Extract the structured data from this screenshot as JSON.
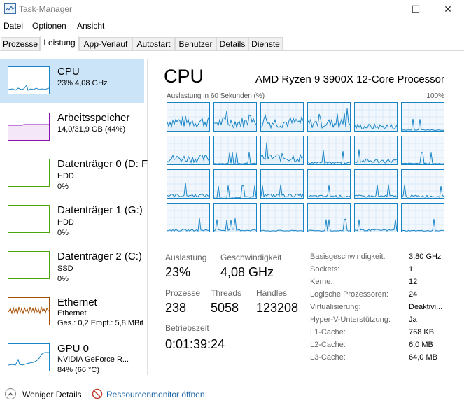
{
  "window": {
    "title": "Task-Manager",
    "minimize": "—",
    "maximize": "☐",
    "close": "✕"
  },
  "menu": [
    "Datei",
    "Optionen",
    "Ansicht"
  ],
  "tabs": [
    "Prozesse",
    "Leistung",
    "App-Verlauf",
    "Autostart",
    "Benutzer",
    "Details",
    "Dienste"
  ],
  "active_tab": "Leistung",
  "sidebar": [
    {
      "title": "CPU",
      "sub1": "23%  4,08 GHz",
      "sub2": "",
      "color": "#1784c6"
    },
    {
      "title": "Arbeitsspeicher",
      "sub1": "14,0/31,9 GB (44%)",
      "sub2": "",
      "color": "#8b12ae"
    },
    {
      "title": "Datenträger 0 (D: F",
      "sub1": "HDD",
      "sub2": "0%",
      "color": "#4da60c"
    },
    {
      "title": "Datenträger 1 (G:)",
      "sub1": "HDD",
      "sub2": "0%",
      "color": "#4da60c"
    },
    {
      "title": "Datenträger 2 (C:)",
      "sub1": "SSD",
      "sub2": "0%",
      "color": "#4da60c"
    },
    {
      "title": "Ethernet",
      "sub1": "Ethernet",
      "sub2": "Ges.: 0,2  Empf.: 5,8 MBit",
      "color": "#a74f01"
    },
    {
      "title": "GPU 0",
      "sub1": "NVIDIA GeForce R...",
      "sub2": "84%  (66 °C)",
      "color": "#1784c6"
    }
  ],
  "cpu": {
    "heading": "CPU",
    "processor": "AMD Ryzen 9 3900X 12-Core Processor",
    "graph_label": "Auslastung in 60 Sekunden (%)",
    "graph_max": "100%",
    "stats": {
      "auslastung_label": "Auslastung",
      "auslastung": "23%",
      "geschwindigkeit_label": "Geschwindigkeit",
      "geschwindigkeit": "4,08 GHz",
      "prozesse_label": "Prozesse",
      "prozesse": "238",
      "threads_label": "Threads",
      "threads": "5058",
      "handles_label": "Handles",
      "handles": "123208",
      "betriebszeit_label": "Betriebszeit",
      "betriebszeit": "0:01:39:24"
    },
    "info": [
      {
        "label": "Basisgeschwindigkeit:",
        "value": "3,80 GHz"
      },
      {
        "label": "Sockets:",
        "value": "1"
      },
      {
        "label": "Kerne:",
        "value": "12"
      },
      {
        "label": "Logische Prozessoren:",
        "value": "24"
      },
      {
        "label": "Virtualisierung:",
        "value": "Deaktivi..."
      },
      {
        "label": "Hyper-V-Unterstützung:",
        "value": "Ja"
      },
      {
        "label": "L1-Cache:",
        "value": "768 KB"
      },
      {
        "label": "L2-Cache:",
        "value": "6,0 MB"
      },
      {
        "label": "L3-Cache:",
        "value": "64,0 MB"
      }
    ]
  },
  "footer": {
    "fewer_details": "Weniger Details",
    "resource_monitor": "Ressourcenmonitor öffnen"
  }
}
